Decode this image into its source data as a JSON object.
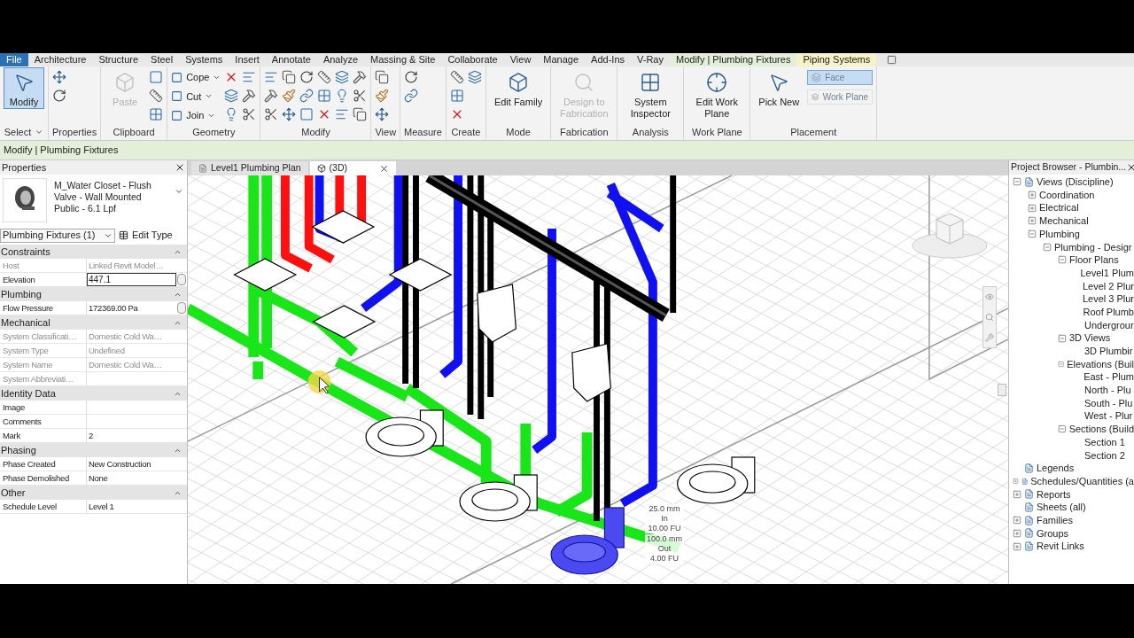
{
  "ribbon": {
    "tabs": [
      {
        "label": "File",
        "kind": "file",
        "selected": false
      },
      {
        "label": "Architecture",
        "kind": "tab",
        "selected": false
      },
      {
        "label": "Structure",
        "kind": "tab",
        "selected": false
      },
      {
        "label": "Steel",
        "kind": "tab",
        "selected": false
      },
      {
        "label": "Systems",
        "kind": "tab",
        "selected": false
      },
      {
        "label": "Insert",
        "kind": "tab",
        "selected": false
      },
      {
        "label": "Annotate",
        "kind": "tab",
        "selected": false
      },
      {
        "label": "Analyze",
        "kind": "tab",
        "selected": false
      },
      {
        "label": "Massing & Site",
        "kind": "tab",
        "selected": false
      },
      {
        "label": "Collaborate",
        "kind": "tab",
        "selected": false
      },
      {
        "label": "View",
        "kind": "tab",
        "selected": false
      },
      {
        "label": "Manage",
        "kind": "tab",
        "selected": false
      },
      {
        "label": "Add-Ins",
        "kind": "tab",
        "selected": false
      },
      {
        "label": "V-Ray",
        "kind": "tab",
        "selected": false
      },
      {
        "label": "Modify | Plumbing Fixtures",
        "kind": "context",
        "selected": true
      },
      {
        "label": "Piping Systems",
        "kind": "context",
        "selected": false
      }
    ],
    "panels": [
      {
        "label": "Select",
        "dropdown": true,
        "buttons": [
          {
            "kind": "large",
            "label": "Modify",
            "selected": true,
            "disabled": false
          }
        ]
      },
      {
        "label": "Properties",
        "buttons": [
          {
            "kind": "icon"
          },
          {
            "kind": "icon"
          }
        ]
      },
      {
        "label": "Clipboard",
        "buttons": [
          {
            "kind": "large",
            "label": "Paste",
            "selected": false,
            "disabled": true
          },
          {
            "kind": "icon"
          },
          {
            "kind": "icon"
          },
          {
            "kind": "icon"
          }
        ]
      },
      {
        "label": "Geometry",
        "buttons": [
          {
            "kind": "small",
            "label": "Cope",
            "selected": false,
            "disabled": false
          },
          {
            "kind": "small",
            "label": "Cut",
            "selected": false,
            "disabled": false
          },
          {
            "kind": "small",
            "label": "Join",
            "selected": false,
            "disabled": false
          },
          {
            "kind": "icon"
          },
          {
            "kind": "icon"
          },
          {
            "kind": "icon"
          },
          {
            "kind": "icon"
          },
          {
            "kind": "icon"
          },
          {
            "kind": "icon"
          }
        ]
      },
      {
        "label": "Modify",
        "buttons": [
          {
            "kind": "icon"
          },
          {
            "kind": "icon"
          },
          {
            "kind": "icon"
          },
          {
            "kind": "icon"
          },
          {
            "kind": "icon"
          },
          {
            "kind": "icon"
          },
          {
            "kind": "icon"
          },
          {
            "kind": "icon"
          },
          {
            "kind": "icon"
          },
          {
            "kind": "icon"
          },
          {
            "kind": "icon"
          },
          {
            "kind": "icon"
          },
          {
            "kind": "icon"
          },
          {
            "kind": "icon"
          },
          {
            "kind": "icon"
          },
          {
            "kind": "icon"
          },
          {
            "kind": "icon"
          },
          {
            "kind": "icon"
          }
        ]
      },
      {
        "label": "View",
        "buttons": [
          {
            "kind": "icon"
          },
          {
            "kind": "icon"
          },
          {
            "kind": "icon"
          }
        ]
      },
      {
        "label": "Measure",
        "buttons": [
          {
            "kind": "icon"
          },
          {
            "kind": "icon"
          }
        ]
      },
      {
        "label": "Create",
        "buttons": [
          {
            "kind": "icon"
          },
          {
            "kind": "icon"
          },
          {
            "kind": "icon"
          },
          {
            "kind": "icon"
          }
        ]
      },
      {
        "label": "Mode",
        "buttons": [
          {
            "kind": "large",
            "label": "Edit Family",
            "selected": false,
            "disabled": false
          }
        ]
      },
      {
        "label": "Fabrication",
        "buttons": [
          {
            "kind": "large",
            "label": "Design to Fabrication",
            "selected": false,
            "disabled": true
          }
        ]
      },
      {
        "label": "Analysis",
        "buttons": [
          {
            "kind": "large",
            "label": "System Inspector",
            "selected": false,
            "disabled": false
          }
        ]
      },
      {
        "label": "Work Plane",
        "buttons": [
          {
            "kind": "large",
            "label": "Edit Work Plane",
            "selected": false,
            "disabled": false
          }
        ]
      },
      {
        "label": "Placement",
        "buttons": [
          {
            "kind": "large",
            "label": "Pick New",
            "selected": false,
            "disabled": false
          },
          {
            "kind": "wide",
            "label": "Face",
            "selected": true,
            "disabled": true
          },
          {
            "kind": "wide",
            "label": "Work Plane",
            "selected": false,
            "disabled": true
          }
        ]
      }
    ]
  },
  "context_bar": {
    "text": "Modify | Plumbing Fixtures"
  },
  "properties": {
    "title": "Properties",
    "type_name": "M_Water Closet - Flush Valve - Wall Mounted Public - 6.1 Lpf",
    "selector": "Plumbing Fixtures (1)",
    "edit_type": "Edit Type",
    "groups": [
      {
        "name": "Constraints",
        "rows": [
          {
            "label": "Host",
            "value": "Linked Revit Model…",
            "kind": "text",
            "disabled": true
          },
          {
            "label": "Elevation",
            "value": "447.1",
            "kind": "edit",
            "disabled": false
          }
        ]
      },
      {
        "name": "Plumbing",
        "rows": [
          {
            "label": "Flow Pressure",
            "value": "172369.00 Pa",
            "kind": "button",
            "disabled": false
          }
        ]
      },
      {
        "name": "Mechanical",
        "rows": [
          {
            "label": "System Classificati…",
            "value": "Domestic Cold Wa…",
            "kind": "text",
            "disabled": true
          },
          {
            "label": "System Type",
            "value": "Undefined",
            "kind": "text",
            "disabled": true
          },
          {
            "label": "System Name",
            "value": "Domestic Cold Wa…",
            "kind": "text",
            "disabled": true
          },
          {
            "label": "System Abbreviati…",
            "kind": "text",
            "disabled": true
          }
        ]
      },
      {
        "name": "Identity Data",
        "rows": [
          {
            "label": "Image",
            "kind": "text",
            "disabled": false
          },
          {
            "label": "Comments",
            "kind": "text",
            "disabled": false
          },
          {
            "label": "Mark",
            "value": "2",
            "kind": "text",
            "disabled": false
          }
        ]
      },
      {
        "name": "Phasing",
        "rows": [
          {
            "label": "Phase Created",
            "value": "New Construction",
            "kind": "text",
            "disabled": false
          },
          {
            "label": "Phase Demolished",
            "value": "None",
            "kind": "text",
            "disabled": false
          }
        ]
      },
      {
        "name": "Other",
        "rows": [
          {
            "label": "Schedule Level",
            "value": "Level 1",
            "kind": "text",
            "disabled": false
          }
        ]
      }
    ]
  },
  "view_tabs": [
    {
      "label": "Level1 Plumbing Plan",
      "selected": false
    },
    {
      "label": "(3D)",
      "selected": true
    }
  ],
  "connector_labels": [
    {
      "size": "25.0 mm",
      "direction": "In",
      "load": "10.00 FU"
    },
    {
      "size": "100.0 mm",
      "direction": "Out",
      "load": "4.00 FU"
    }
  ],
  "project_browser": {
    "title": "Project Browser - Plumbin...",
    "items": [
      {
        "label": "Views (Discipline)",
        "expanded": true,
        "children": [
          {
            "label": "Coordination",
            "expanded": false
          },
          {
            "label": "Electrical",
            "expanded": false
          },
          {
            "label": "Mechanical",
            "expanded": false
          },
          {
            "label": "Plumbing",
            "expanded": true,
            "children": [
              {
                "label": "Plumbing - Desigr",
                "expanded": true,
                "children": [
                  {
                    "label": "Floor Plans",
                    "expanded": true,
                    "children": [
                      {
                        "label": "Level1 Plum"
                      },
                      {
                        "label": "Level 2 Plur"
                      },
                      {
                        "label": "Level 3 Plur"
                      },
                      {
                        "label": "Roof Plumb"
                      },
                      {
                        "label": "Undergrour"
                      }
                    ]
                  },
                  {
                    "label": "3D Views",
                    "expanded": true,
                    "children": [
                      {
                        "label": "3D Plumbir"
                      }
                    ]
                  },
                  {
                    "label": "Elevations (Buil",
                    "expanded": true,
                    "children": [
                      {
                        "label": "East - Plum"
                      },
                      {
                        "label": "North - Plu"
                      },
                      {
                        "label": "South - Plu"
                      },
                      {
                        "label": "West - Plur"
                      }
                    ]
                  },
                  {
                    "label": "Sections (Build",
                    "expanded": true,
                    "children": [
                      {
                        "label": "Section 1"
                      },
                      {
                        "label": "Section 2"
                      }
                    ]
                  }
                ]
              }
            ]
          }
        ]
      },
      {
        "label": "Legends"
      },
      {
        "label": "Schedules/Quantities (a",
        "expanded": false
      },
      {
        "label": "Reports",
        "expanded": false
      },
      {
        "label": "Sheets (all)"
      },
      {
        "label": "Families",
        "expanded": false
      },
      {
        "label": "Groups",
        "expanded": false
      },
      {
        "label": "Revit Links",
        "expanded": false
      }
    ]
  }
}
